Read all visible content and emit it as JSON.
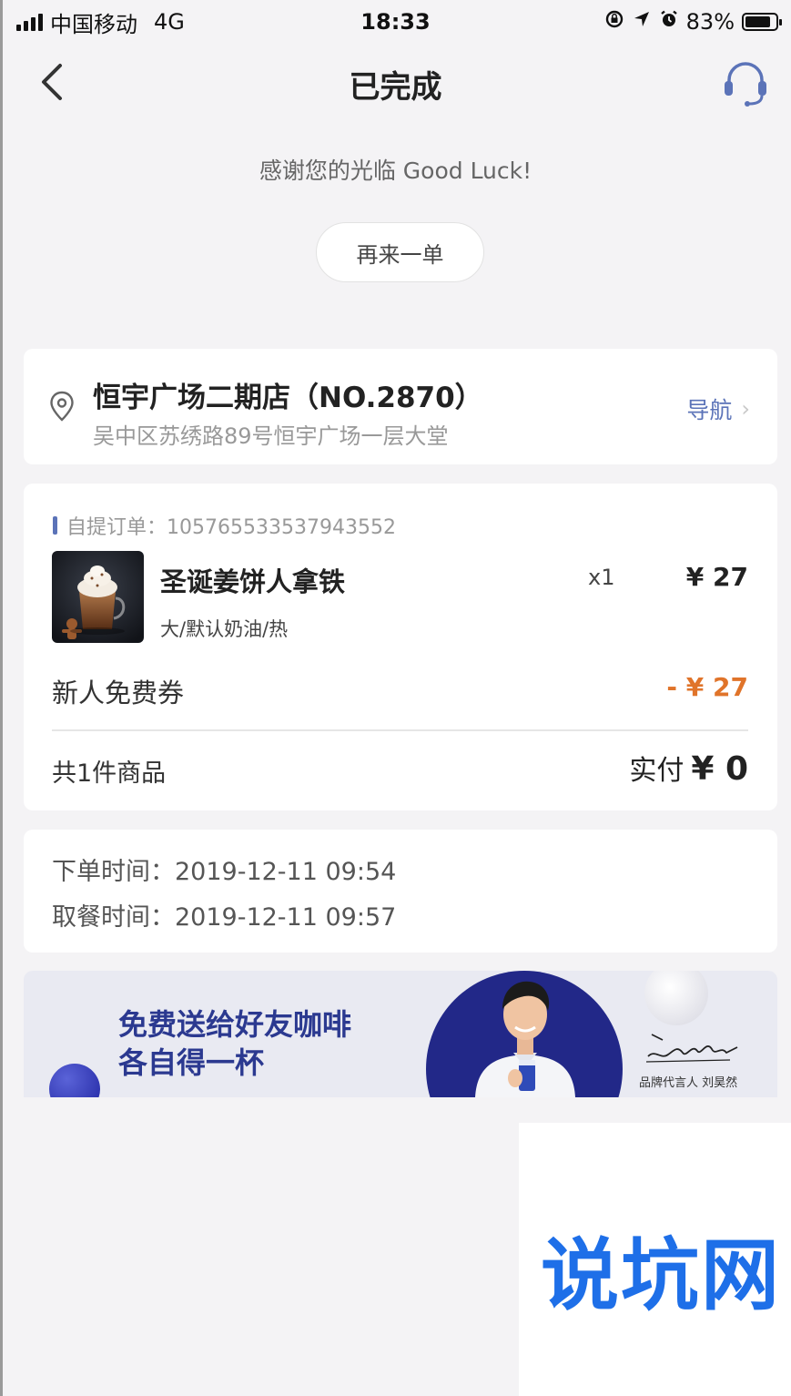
{
  "status_bar": {
    "carrier": "中国移动",
    "network": "4G",
    "time": "18:33",
    "battery_percent": "83%",
    "battery_level": 0.83,
    "icons": [
      "signal-icon",
      "lock-rotation-icon",
      "location-arrow-icon",
      "alarm-icon",
      "battery-icon"
    ]
  },
  "nav": {
    "title": "已完成",
    "back_icon": "chevron-left-icon",
    "service_icon": "headset-icon"
  },
  "thanks_message": "感谢您的光临 Good Luck!",
  "reorder_label": "再来一单",
  "store": {
    "name": "恒宇广场二期店（NO.2870）",
    "address": "吴中区苏绣路89号恒宇广场一层大堂",
    "nav_label": "导航",
    "nav_chevron": "›"
  },
  "order": {
    "type_label": "自提订单：",
    "order_no": "105765533537943552",
    "product": {
      "name": "圣诞姜饼人拿铁",
      "spec": "大/默认奶油/热",
      "qty": "x1",
      "price": "¥ 27"
    },
    "coupon": {
      "label": "新人免费券",
      "value": "- ¥ 27"
    },
    "summary": {
      "count": "共1件商品",
      "paid_label": "实付",
      "paid_amount": "¥ 0"
    }
  },
  "times": {
    "order_label": "下单时间：",
    "order_time": "2019-12-11 09:54",
    "pickup_label": "取餐时间：",
    "pickup_time": "2019-12-11 09:57"
  },
  "banner": {
    "line1": "免费送给好友咖啡",
    "line2": "各自得一杯",
    "ambassador": "品牌代言人 刘昊然"
  },
  "watermark": "说坑网",
  "colors": {
    "background": "#f4f3f5",
    "accent_blue": "#5b73b8",
    "discount_orange": "#e0742a",
    "banner_navy": "#222888",
    "watermark_blue": "#1e6fe8"
  }
}
